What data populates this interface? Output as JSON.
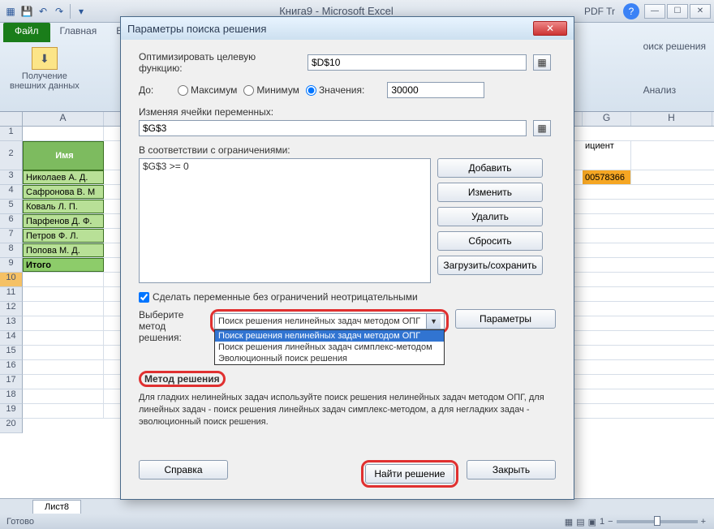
{
  "window": {
    "title": "Книга9 - Microsoft Excel"
  },
  "ribbon": {
    "file": "Файл",
    "tabs": [
      "Главная",
      "В"
    ],
    "group1_btn": "Получение\nвнешних данных",
    "right1": "оиск решения",
    "right2": "Анализ",
    "pdf": "PDF Tr"
  },
  "columns": [
    "A",
    "",
    "",
    "",
    "",
    "",
    "G",
    "H"
  ],
  "rows_numbers": [
    "1",
    "2",
    "3",
    "4",
    "5",
    "6",
    "7",
    "8",
    "9",
    "10",
    "11",
    "12",
    "13",
    "14",
    "15",
    "16",
    "17",
    "18",
    "19",
    "20"
  ],
  "data": {
    "header_name": "Имя",
    "names": [
      "Николаев А. Д.",
      "Сафронова В. М",
      "Коваль Л. П.",
      "Парфенов Д. Ф.",
      "Петров Ф. Л.",
      "Попова М. Д."
    ],
    "total": "Итого",
    "coef_label": "ициент",
    "coef_value": "00578366"
  },
  "sheet_tab": "Лист8",
  "status": {
    "ready": "Готово",
    "zoom": "1"
  },
  "dialog": {
    "title": "Параметры поиска решения",
    "optimize_label": "Оптимизировать целевую функцию:",
    "target_cell": "$D$10",
    "to_label": "До:",
    "opt_max": "Максимум",
    "opt_min": "Минимум",
    "opt_val": "Значения:",
    "value": "30000",
    "vars_label": "Изменяя ячейки переменных:",
    "vars_value": "$G$3",
    "constraints_label": "В соответствии с ограничениями:",
    "constraint1": "$G$3 >= 0",
    "btn_add": "Добавить",
    "btn_change": "Изменить",
    "btn_delete": "Удалить",
    "btn_reset": "Сбросить",
    "btn_loadsave": "Загрузить/сохранить",
    "check_nonneg": "Сделать переменные без ограничений неотрицательными",
    "select_label1": "Выберите",
    "select_label2": "метод решения:",
    "select_value": "Поиск решения нелинейных задач методом ОПГ",
    "dd_items": [
      "Поиск решения нелинейных задач методом ОПГ",
      "Поиск решения линейных задач симплекс-методом",
      "Эволюционный поиск решения"
    ],
    "btn_params": "Параметры",
    "method_group": "Метод решения",
    "desc": "Для гладких нелинейных задач используйте поиск решения нелинейных задач методом ОПГ, для линейных задач - поиск решения линейных задач симплекс-методом, а для негладких задач - эволюционный поиск решения.",
    "btn_help": "Справка",
    "btn_solve": "Найти решение",
    "btn_close": "Закрыть"
  }
}
